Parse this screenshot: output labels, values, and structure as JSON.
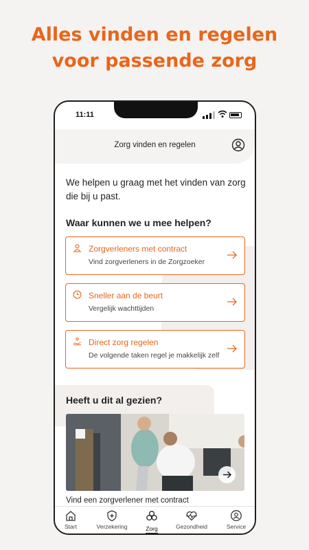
{
  "promo": {
    "line1": "Alles vinden en regelen",
    "line2": "voor passende zorg"
  },
  "status_bar": {
    "time": "11:11"
  },
  "header": {
    "title": "Zorg vinden en regelen",
    "profile_icon": "user-circle-icon"
  },
  "intro": "We helpen u graag met het vinden van zorg die bij u past.",
  "help_title": "Waar kunnen we u mee helpen?",
  "cards": [
    {
      "icon": "location-person-icon",
      "title": "Zorgverleners met contract",
      "subtitle": "Vind zorgverleners in de Zorgzoeker"
    },
    {
      "icon": "clock-icon",
      "title": "Sneller aan de beurt",
      "subtitle": "Vergelijk wachttijden"
    },
    {
      "icon": "hand-care-icon",
      "title": "Direct zorg regelen",
      "subtitle": "De volgende taken regel je makkelijk zelf"
    }
  ],
  "seen_title": "Heeft u dit al gezien?",
  "photo_caption": "Vind een zorgverlener met contract",
  "tabs": [
    {
      "icon": "home-icon",
      "label": "Start"
    },
    {
      "icon": "shield-plus-icon",
      "label": "Verzekering"
    },
    {
      "icon": "pills-icon",
      "label": "Zorg",
      "active": true
    },
    {
      "icon": "heartbeat-icon",
      "label": "Gezondheid"
    },
    {
      "icon": "service-icon",
      "label": "Service"
    }
  ],
  "colors": {
    "accent": "#e8661c",
    "background": "#f5f3f1"
  }
}
